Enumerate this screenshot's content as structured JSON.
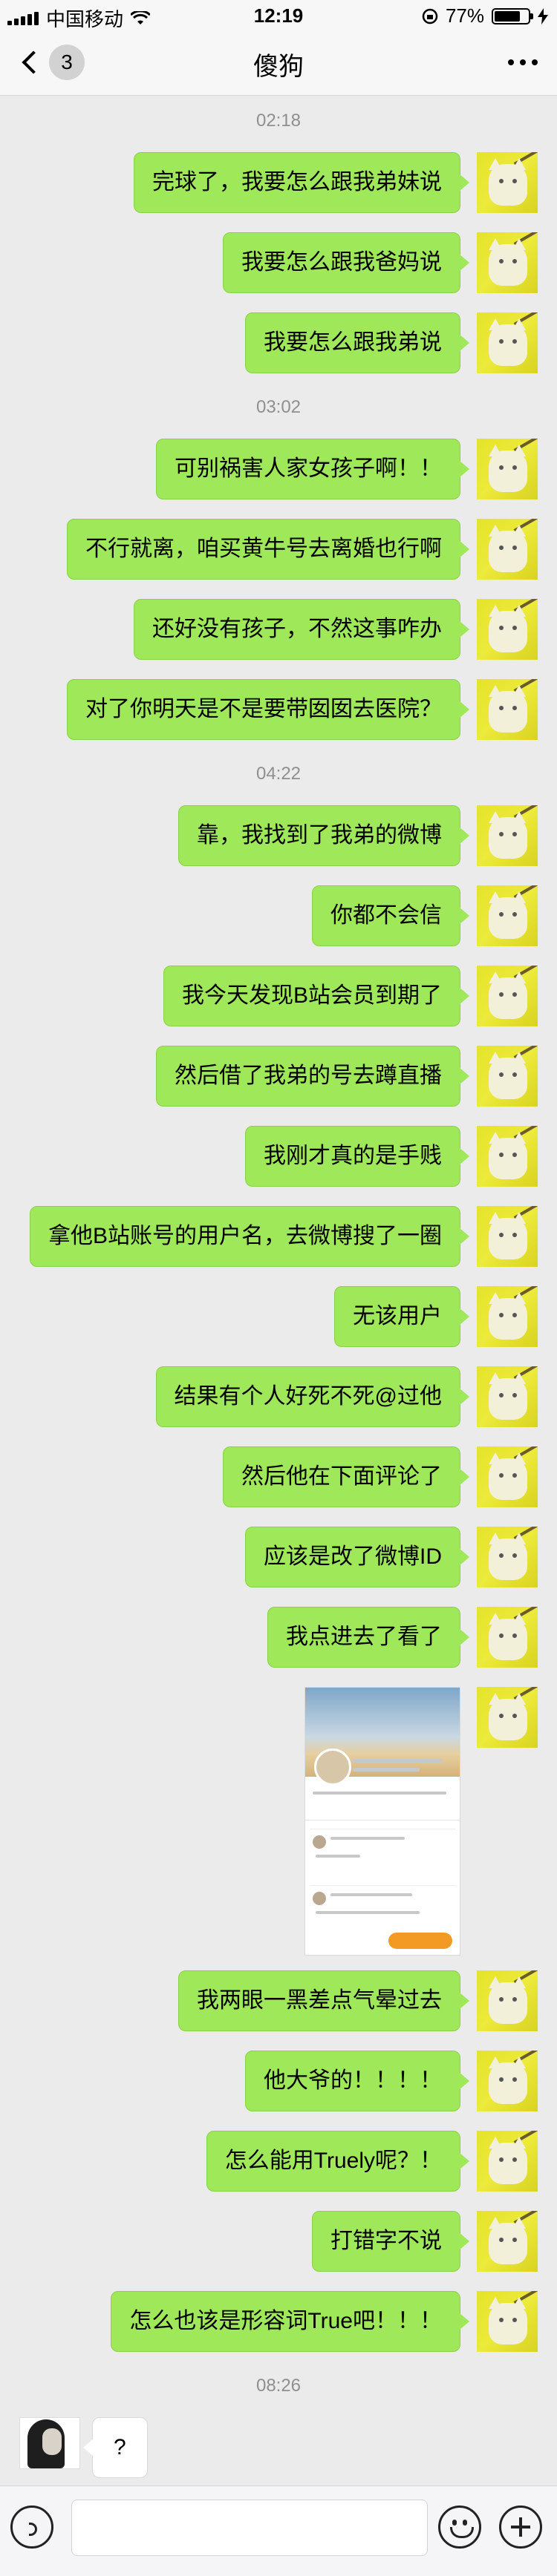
{
  "status_bar": {
    "carrier": "中国移动",
    "time": "12:19",
    "battery_text": "77%",
    "battery_level": 0.77
  },
  "nav": {
    "back_count": "3",
    "title": "傻狗"
  },
  "messages": [
    {
      "kind": "time",
      "text": "02:18"
    },
    {
      "kind": "out",
      "text": "完球了，我要怎么跟我弟妹说"
    },
    {
      "kind": "out",
      "text": "我要怎么跟我爸妈说"
    },
    {
      "kind": "out",
      "text": "我要怎么跟我弟说"
    },
    {
      "kind": "time",
      "text": "03:02"
    },
    {
      "kind": "out",
      "text": "可别祸害人家女孩子啊！！"
    },
    {
      "kind": "out",
      "text": "不行就离，咱买黄牛号去离婚也行啊"
    },
    {
      "kind": "out",
      "text": "还好没有孩子，不然这事咋办"
    },
    {
      "kind": "out",
      "text": "对了你明天是不是要带囡囡去医院？"
    },
    {
      "kind": "time",
      "text": "04:22"
    },
    {
      "kind": "out",
      "text": "靠，我找到了我弟的微博"
    },
    {
      "kind": "out",
      "text": "你都不会信"
    },
    {
      "kind": "out",
      "text": "我今天发现B站会员到期了"
    },
    {
      "kind": "out",
      "text": "然后借了我弟的号去蹲直播"
    },
    {
      "kind": "out",
      "text": "我刚才真的是手贱"
    },
    {
      "kind": "out",
      "text": "拿他B站账号的用户名，去微博搜了一圈"
    },
    {
      "kind": "out",
      "text": "无该用户"
    },
    {
      "kind": "out",
      "text": "结果有个人好死不死@过他"
    },
    {
      "kind": "out",
      "text": "然后他在下面评论了"
    },
    {
      "kind": "out",
      "text": "应该是改了微博ID"
    },
    {
      "kind": "out",
      "text": "我点进去了看了"
    },
    {
      "kind": "out_image",
      "text": ""
    },
    {
      "kind": "out",
      "text": "我两眼一黑差点气晕过去"
    },
    {
      "kind": "out",
      "text": "他大爷的！！！！"
    },
    {
      "kind": "out",
      "text": "怎么能用Truely呢？！"
    },
    {
      "kind": "out",
      "text": "打错字不说"
    },
    {
      "kind": "out",
      "text": "怎么也该是形容词True吧！！！"
    },
    {
      "kind": "time",
      "text": "08:26"
    },
    {
      "kind": "in",
      "text": "?"
    }
  ],
  "input": {
    "value": "",
    "placeholder": ""
  },
  "colors": {
    "bubble_out": "#9ee85a",
    "bubble_in": "#ffffff",
    "background": "#ebebeb",
    "bar": "#f7f7f7"
  },
  "icons": [
    "back-chevron-icon",
    "more-icon",
    "voice-icon",
    "emoji-icon",
    "plus-icon",
    "wifi-icon",
    "signal-icon",
    "battery-icon"
  ]
}
